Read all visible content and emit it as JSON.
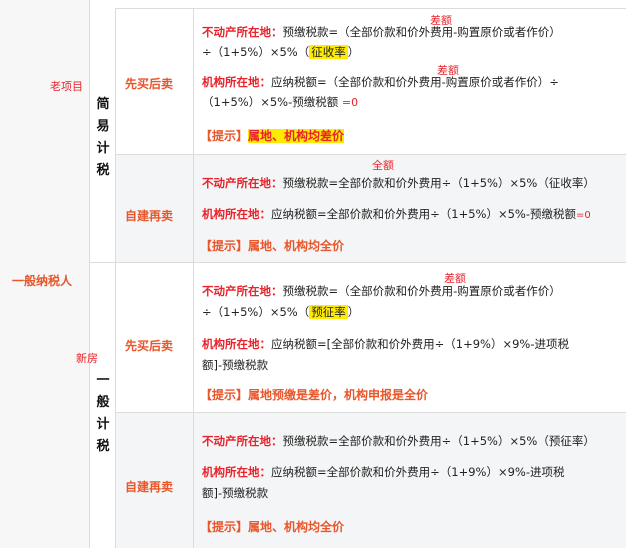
{
  "col1": {
    "label": "一般纳税人",
    "note_old": "老项目",
    "note_new": "新房"
  },
  "col2": {
    "simple": "简易计税",
    "general": "一般计税"
  },
  "rows": [
    {
      "method": "先买后卖",
      "note_top": "差额",
      "line1_key": "不动产所在地：",
      "line1a": "预缴税款=（全部价款和价外费用-购置原价或者作价）",
      "line1b": "÷（1+5%）×5%（",
      "line1_hl": "征收率",
      "line1c": "）",
      "note_mid": "差额",
      "line2_key": "机构所在地：",
      "line2a": "应纳税额=（全部价款和价外费用-购置原价或者作价）÷",
      "line2b": "（1+5%）×5%-预缴税额",
      "line2_eq": "=0",
      "tip_a": "【提示】",
      "tip_b": "属地、机构均差价"
    },
    {
      "method": "自建再卖",
      "note_top": "全额",
      "line1_key": "不动产所在地：",
      "line1a": "预缴税款=全部价款和价外费用÷（1+5%）×5%（征收率）",
      "line2_key": "机构所在地：",
      "line2a": "应纳税额=全部价款和价外费用÷（1+5%）×5%-预缴税额",
      "line2_eq": "=0",
      "tip_a": "【提示】",
      "tip_b": "属地、机构均全价"
    },
    {
      "method": "先买后卖",
      "note_top": "差额",
      "line1_key": "不动产所在地：",
      "line1a": "预缴税款=（全部价款和价外费用-购置原价或者作价）",
      "line1b": "÷（1+5%）×5%（",
      "line1_hl": "预征率",
      "line1c": "）",
      "line2_key": "机构所在地：",
      "line2a": "应纳税额=[全部价款和价外费用÷（1+9%）×9%-进项税",
      "line2b": "额]-预缴税款",
      "tip_a": "【提示】",
      "tip_b": "属地预缴是差价，机构申报是全价"
    },
    {
      "method": "自建再卖",
      "line1_key": "不动产所在地：",
      "line1a": "预缴税款=全部价款和价外费用÷（1+5%）×5%（预征率）",
      "line2_key": "机构所在地：",
      "line2a": "应纳税额=全部价款和价外费用÷（1+9%）×9%-进项税",
      "line2b": "额]-预缴税款",
      "tip_a": "【提示】",
      "tip_b": "属地、机构均全价"
    }
  ]
}
